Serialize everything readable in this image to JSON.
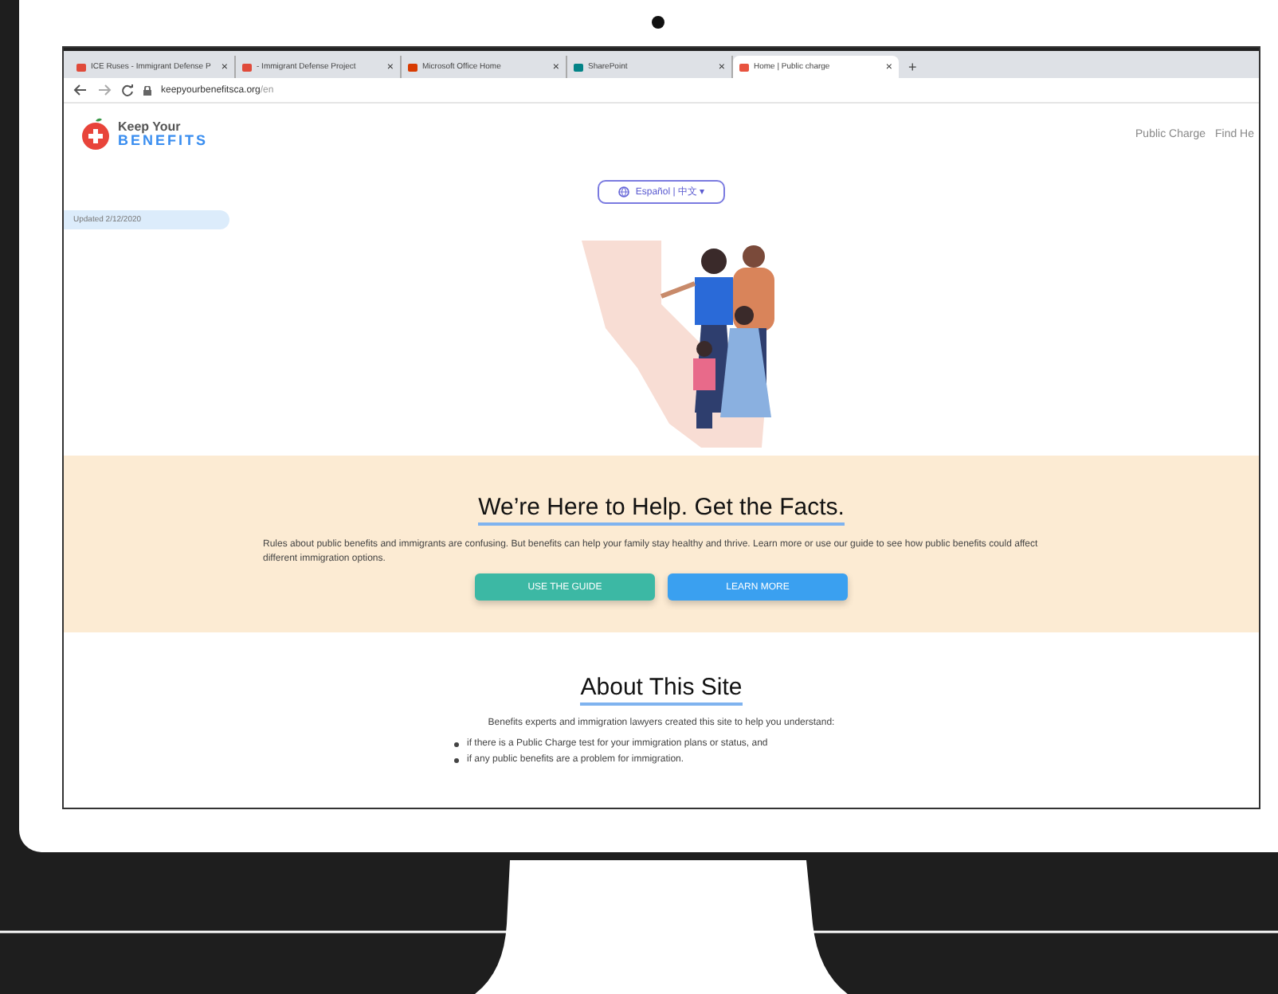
{
  "browser": {
    "tabs": [
      {
        "label": "ICE Ruses - Immigrant Defense P",
        "selected": false,
        "color": "#e04a3a"
      },
      {
        "label": "- Immigrant Defense Project",
        "selected": false,
        "color": "#e04a3a"
      },
      {
        "label": "Microsoft Office Home",
        "selected": false,
        "color": "#d83b01"
      },
      {
        "label": "SharePoint",
        "selected": false,
        "color": "#038387"
      },
      {
        "label": "Home | Public charge",
        "selected": true,
        "color": "#e8533f"
      }
    ],
    "close_glyph": "×",
    "new_tab_glyph": "+",
    "url_host": "keepyourbenefitsca.org",
    "url_path": "/en"
  },
  "site": {
    "logo": {
      "line_1": "Keep Your",
      "line_2": "BENEFITS"
    },
    "nav": [
      "Public Charge",
      "Find He"
    ],
    "language_button": "Español | 中文 ▾",
    "updated": "Updated 2/12/2020",
    "hero": {
      "title": "We’re Here to Help. Get the Facts.",
      "text": "Rules about public benefits and immigrants are confusing. But benefits can help your family stay healthy and thrive. Learn more or use our guide to see how public benefits could affect different immigration options.",
      "buttons": [
        {
          "label": "USE THE GUIDE",
          "color": "#3cb8a4"
        },
        {
          "label": "LEARN MORE",
          "color": "#3aa0f0"
        }
      ]
    },
    "about": {
      "title": "About This Site",
      "intro": "Benefits experts and immigration lawyers created this site to help you understand:",
      "points": [
        "if there is a Public Charge test for your immigration plans or status, and",
        "if any public benefits are a problem for immigration."
      ]
    }
  }
}
